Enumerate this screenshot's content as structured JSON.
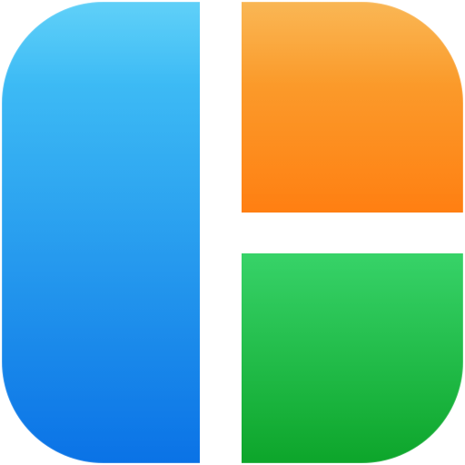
{
  "icon": {
    "name": "collage-layout-icon",
    "panels": {
      "left": {
        "semantic": "blue-panel",
        "gradient_top": "#39C5F7",
        "gradient_bottom": "#0A72E6"
      },
      "top_right": {
        "semantic": "orange-panel",
        "gradient_top": "#F8A52B",
        "gradient_bottom": "#FF7A08"
      },
      "bottom_right": {
        "semantic": "green-panel",
        "gradient_top": "#30D163",
        "gradient_bottom": "#0DA52A"
      }
    },
    "divider_color": "#FFFFFF"
  }
}
